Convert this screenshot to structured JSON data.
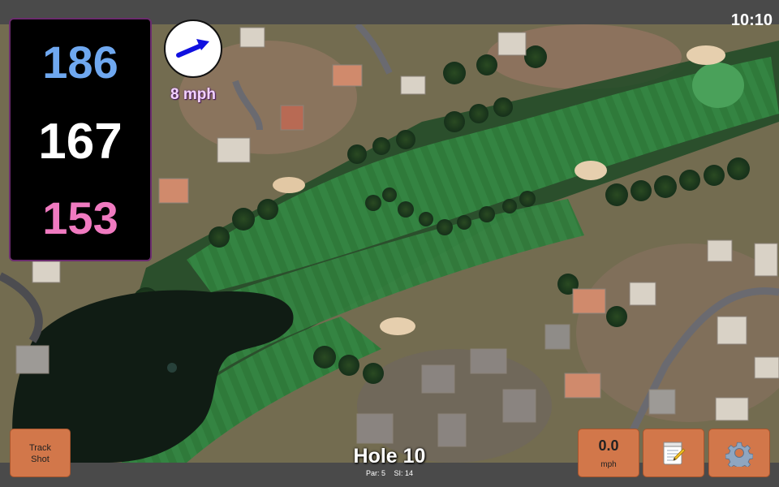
{
  "status_bar": {
    "time": "10:10"
  },
  "distances": {
    "back": "186",
    "middle": "167",
    "front": "153"
  },
  "wind": {
    "speed": "8 mph",
    "direction_icon": "arrow-icon"
  },
  "buttons": {
    "track_shot_line1": "Track",
    "track_shot_line2": "Shot",
    "speed_value": "0.0",
    "speed_unit": "mph",
    "notes_icon": "notepad-icon",
    "settings_icon": "gear-icon"
  },
  "hole": {
    "title": "Hole 10",
    "par": "Par: 5",
    "si": "SI: 14"
  },
  "colors": {
    "back_distance": "#6fa8f0",
    "middle_distance": "#ffffff",
    "front_distance": "#f07ac0",
    "button": "#d2774a",
    "wind_arrow": "#1010e0"
  }
}
